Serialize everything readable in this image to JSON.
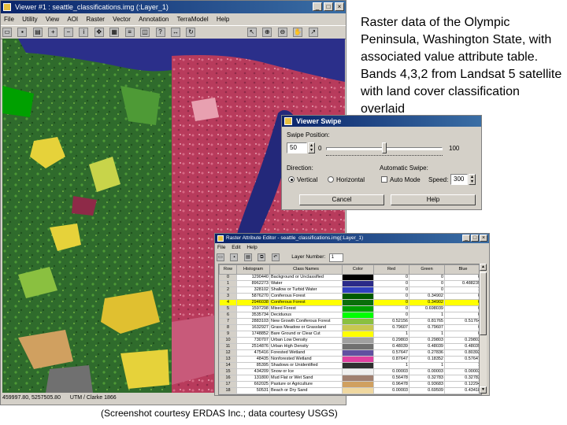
{
  "viewer": {
    "title": "Viewer #1 : seattle_classifications.img (:Layer_1)",
    "menu": [
      "File",
      "Utility",
      "View",
      "AOI",
      "Raster",
      "Vector",
      "Annotation",
      "TerraModel",
      "Help"
    ],
    "status": [
      "459997.80, 5257505.80",
      "UTM / Clarke 1866"
    ],
    "colors": {
      "left_forest": "#2f6b2c",
      "right_land": "#b83b5c",
      "water": "#2b2f8a"
    }
  },
  "caption": "Raster data of the Olympic Peninsula, Washington State, with associated value attribute table. Bands 4,3,2 from Landsat 5 satellite with land cover classification overlaid",
  "credit": "(Screenshot courtesy ERDAS Inc.; data courtesy USGS)",
  "swipe_dialog": {
    "title": "Viewer Swipe",
    "swipe_position_label": "Swipe Position:",
    "swipe_value": "50",
    "slider_min": "0",
    "slider_max": "100",
    "slider_fraction": 0.5,
    "direction_label": "Direction:",
    "vertical_label": "Vertical",
    "horizontal_label": "Horizontal",
    "auto_swipe_label": "Automatic Swipe:",
    "auto_mode_label": "Auto Mode",
    "speed_label": "Speed:",
    "speed_value": "300",
    "cancel_label": "Cancel",
    "help_label": "Help"
  },
  "attr_editor": {
    "title": "Raster Attribute Editor - seattle_classifications.img(:Layer_1)",
    "menu": [
      "File",
      "Edit",
      "Help"
    ],
    "layer_label": "Layer Number:",
    "layer_value": "1",
    "columns": [
      "Row",
      "Histogram",
      "Class Names",
      "Color",
      "Red",
      "Green",
      "Blue"
    ],
    "rows": [
      {
        "row": "0",
        "hist": "1290440",
        "name": "Background or Unclassified",
        "color": "#000000",
        "red": "0",
        "green": "0",
        "blue": "0"
      },
      {
        "row": "1",
        "hist": "8962273",
        "name": "Water",
        "color": "#2a2a88",
        "red": "0",
        "green": "0",
        "blue": "0.488239"
      },
      {
        "row": "2",
        "hist": "328102",
        "name": "Shallow or Turbid Water",
        "color": "#3040c0",
        "red": "0",
        "green": "0",
        "blue": "1"
      },
      {
        "row": "3",
        "hist": "5876270",
        "name": "Coniferous Forest",
        "color": "#005a00",
        "red": "0",
        "green": "0.34902",
        "blue": "0"
      },
      {
        "row": "4",
        "hist": "2946038",
        "name": "Coniferous Forest",
        "color": "#0a6e0a",
        "red": "0",
        "green": "0.34902",
        "blue": "0"
      },
      {
        "row": "5",
        "hist": "1597298",
        "name": "Mixed Forest",
        "color": "#00a000",
        "red": "0",
        "green": "0.698039",
        "blue": "0"
      },
      {
        "row": "6",
        "hist": "3535734",
        "name": "Deciduous",
        "color": "#00ff00",
        "red": "0",
        "green": "1",
        "blue": "0"
      },
      {
        "row": "7",
        "hist": "2883103",
        "name": "New Growth Coniferous Forest",
        "color": "#8ac040",
        "red": "0.52156",
        "green": "0.81765",
        "blue": "0.51764"
      },
      {
        "row": "8",
        "hist": "1632927",
        "name": "Grass Meadow or Grassland",
        "color": "#c8c850",
        "red": "0.79607",
        "green": "0.79607",
        "blue": "0"
      },
      {
        "row": "9",
        "hist": "1748852",
        "name": "Bare Ground or Clear Cut",
        "color": "#ffff00",
        "red": "1",
        "green": "1",
        "blue": "0"
      },
      {
        "row": "10",
        "hist": "730707",
        "name": "Urban Low Density",
        "color": "#a0a0a0",
        "red": "0.29803",
        "green": "0.29803",
        "blue": "0.29803"
      },
      {
        "row": "11",
        "hist": "2514876",
        "name": "Urban High Density",
        "color": "#707070",
        "red": "0.48039",
        "green": "0.48039",
        "blue": "0.48039"
      },
      {
        "row": "12",
        "hist": "475416",
        "name": "Forested Wetland",
        "color": "#6050a0",
        "red": "0.57647",
        "green": "0.27836",
        "blue": "0.80392"
      },
      {
        "row": "13",
        "hist": "48435",
        "name": "Nonforested Wetland",
        "color": "#e040a0",
        "red": "0.87647",
        "green": "0.18352",
        "blue": "0.57647"
      },
      {
        "row": "14",
        "hist": "85395",
        "name": "Shadows or Unidentified",
        "color": "#303030",
        "red": "1",
        "green": "1",
        "blue": "1"
      },
      {
        "row": "15",
        "hist": "434209",
        "name": "Snow or Ice",
        "color": "#f0f0f0",
        "red": "0.00003",
        "green": "0.00003",
        "blue": "0.00003"
      },
      {
        "row": "16",
        "hist": "131800",
        "name": "Mud Flat or Wet Sand",
        "color": "#a08070",
        "red": "0.56478",
        "green": "0.32783",
        "blue": "0.32783"
      },
      {
        "row": "17",
        "hist": "662025",
        "name": "Pasture or Agriculture",
        "color": "#d0a060",
        "red": "0.96478",
        "green": "0.93683",
        "blue": "0.12294"
      },
      {
        "row": "18",
        "hist": "50531",
        "name": "Beach or Dry Sand",
        "color": "#f0d8a0",
        "red": "0.00003",
        "green": "0.69509",
        "blue": "0.43418"
      }
    ],
    "selected_row": "4"
  }
}
